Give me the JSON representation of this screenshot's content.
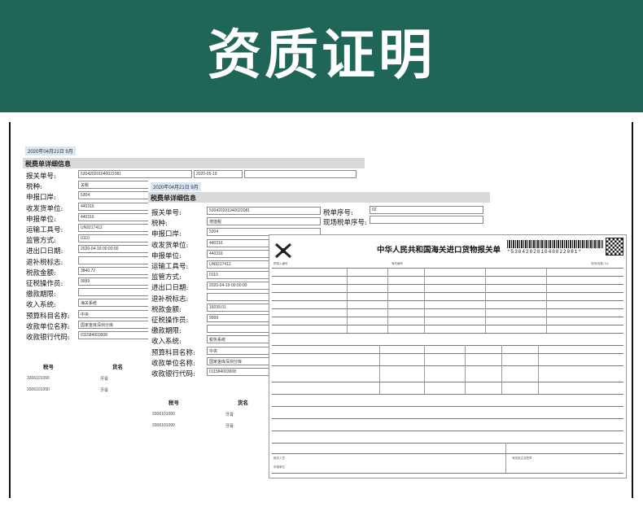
{
  "banner": {
    "title": "资质证明"
  },
  "doc_a": {
    "date": "2020年04月21日  9月",
    "section_title": "税费单详细信息",
    "fields": [
      {
        "label": "报关单号:",
        "value": "530420201040022081"
      },
      {
        "label": "税种:",
        "value": "关税"
      },
      {
        "label": "申报口岸:",
        "value": "5304"
      },
      {
        "label": "收发货单位:",
        "value": "440316"
      },
      {
        "label": "申报单位:",
        "value": "440316"
      },
      {
        "label": "运输工具号:",
        "value": "UN9217412"
      },
      {
        "label": "监管方式:",
        "value": "0110"
      },
      {
        "label": "进出口日期:",
        "value": "2020-04-19 00:00:00"
      },
      {
        "label": "退补税标志:",
        "value": ""
      },
      {
        "label": "税款金额:",
        "value": "3840.72"
      },
      {
        "label": "征税操作员:",
        "value": "9999"
      },
      {
        "label": "缴款期限:",
        "value": ""
      },
      {
        "label": "收入系统:",
        "value": "海关系统"
      },
      {
        "label": "预算科目名称:",
        "value": "中央"
      },
      {
        "label": "收款单位名称:",
        "value": "国家金库深圳分库"
      },
      {
        "label": "收款银行代码:",
        "value": "011584003008"
      }
    ],
    "top_right_box": "2020-05-19",
    "tax_table": {
      "headers": [
        "税号",
        "货名"
      ],
      "rows": [
        [
          "3306101090",
          "牙膏"
        ],
        [
          "3306101090",
          "牙膏"
        ]
      ]
    }
  },
  "doc_b": {
    "date": "2020年04月21日  9月",
    "section_title": "税费单详细信息",
    "fields": [
      {
        "label": "报关单号:",
        "value": "530420201040022081"
      },
      {
        "label": "税种:",
        "value": "增值税"
      },
      {
        "label": "申报口岸:",
        "value": "5304"
      },
      {
        "label": "收发货单位:",
        "value": "440316"
      },
      {
        "label": "申报单位:",
        "value": "440316"
      },
      {
        "label": "运输工具号:",
        "value": "UN9217412"
      },
      {
        "label": "监管方式:",
        "value": "0110"
      },
      {
        "label": "进出口日期:",
        "value": "2020-04-19 00:00:00"
      },
      {
        "label": "退补税标志:",
        "value": ""
      },
      {
        "label": "税款金额:",
        "value": "16039.01"
      },
      {
        "label": "征税操作员:",
        "value": "9999"
      },
      {
        "label": "缴款期限:",
        "value": ""
      },
      {
        "label": "收入系统:",
        "value": "税务系统"
      },
      {
        "label": "预算科目名称:",
        "value": "中央"
      },
      {
        "label": "收款单位名称:",
        "value": "国家金库深圳分库"
      },
      {
        "label": "收款银行代码:",
        "value": "011584003008"
      }
    ],
    "right_fields": [
      {
        "label": "税单序号:",
        "value": "02"
      },
      {
        "label": "现场税单序号:",
        "value": ""
      }
    ],
    "tax_table": {
      "headers": [
        "税号",
        "货名"
      ],
      "rows": [
        [
          "3306101090",
          "牙膏"
        ],
        [
          "3306101090",
          "牙膏"
        ]
      ]
    }
  },
  "doc_c": {
    "title": "中华人民共和国海关进口货物报关单",
    "barcode_text": "*530420201040022081*",
    "page_label": "页码/页数: 1/1",
    "pre_entry_label": "预录入编号",
    "customs_no_label": "海关编号",
    "footer_labels": [
      "报关人员",
      "申报单位",
      "海关批注及签章"
    ]
  }
}
